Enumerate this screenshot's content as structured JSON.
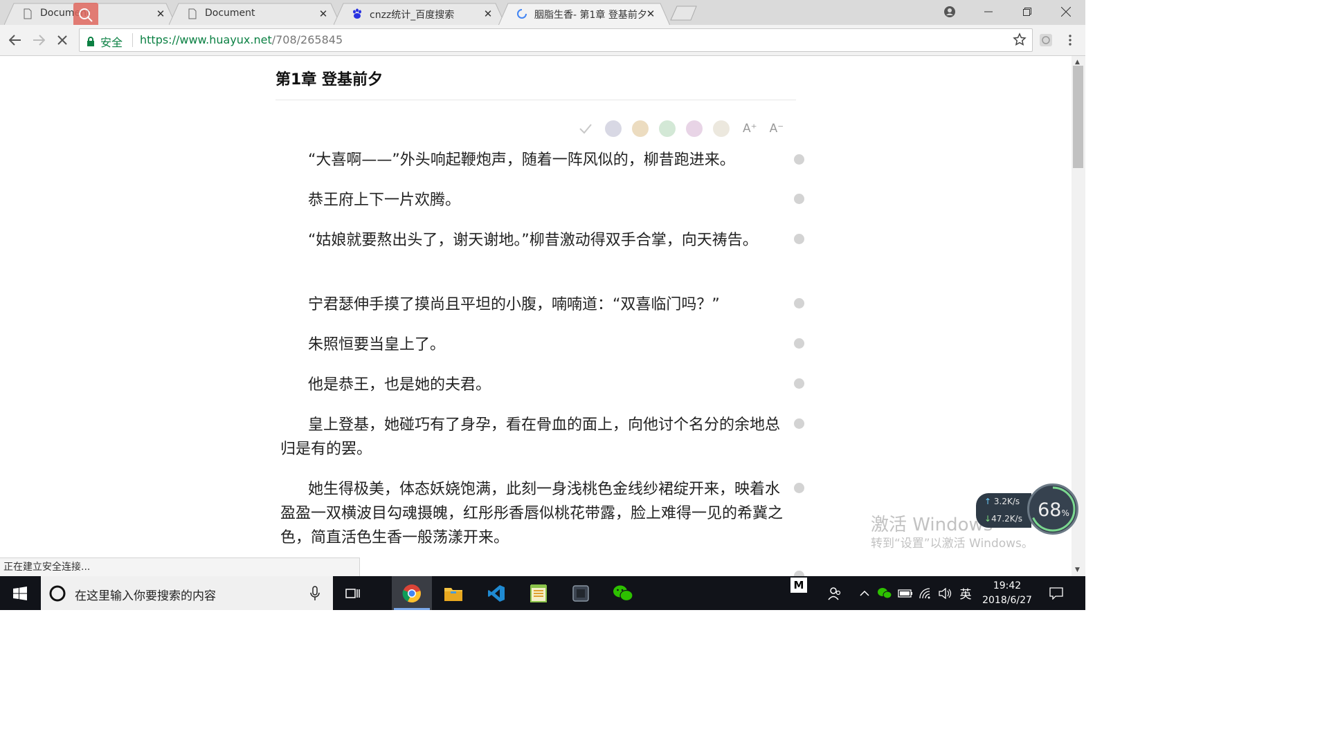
{
  "tabs": [
    {
      "label": "Document",
      "icon": "page-icon",
      "active": false
    },
    {
      "label": "Document",
      "icon": "page-icon",
      "active": false
    },
    {
      "label": "cnzz统计_百度搜索",
      "icon": "baidu-icon",
      "active": false
    },
    {
      "label": "胭脂生香- 第1章 登基前夕",
      "icon": "loading-spinner-icon",
      "active": true
    }
  ],
  "toolbar": {
    "secure_label": "安全",
    "url_host": "https://www.huayux.net",
    "url_path": "/708/265845"
  },
  "chapter": {
    "title": "第1章 登基前夕",
    "paragraphs": [
      "“大喜啊——”外头响起鞭炮声，随着一阵风似的，柳昔跑进来。",
      "恭王府上下一片欢腾。",
      "“姑娘就要熬出头了，谢天谢地。”柳昔激动得双手合掌，向天祷告。",
      "宁君瑟伸手摸了摸尚且平坦的小腹，喃喃道：“双喜临门吗？”",
      "朱照恒要当皇上了。",
      "他是恭王，也是她的夫君。",
      "皇上登基，她碰巧有了身孕，看在骨血的面上，向他讨个名分的余地总归是有的罢。",
      "她生得极美，体态妖娆饱满，此刻一身浅桃色金线纱裙绽开来，映着水盈盈一双横波目勾魂摄魄，红彤彤香唇似桃花带露，脸上难得一见的希冀之色，简直活色生香一般荡漾开来。"
    ]
  },
  "reader_settings": {
    "themes": [
      "#d8d8e4",
      "#ecdcc0",
      "#d3e8d6",
      "#e8d4e6",
      "#ece8de"
    ],
    "font_up": "A⁺",
    "font_down": "A⁻"
  },
  "status_text": "正在建立安全连接...",
  "watermark": {
    "line1": "激活 Windows",
    "line2": "转到“设置”以激活 Windows。"
  },
  "net_monitor": {
    "up": "3.2K/s",
    "down": "47.2K/s",
    "percent": "68",
    "percent_unit": "%"
  },
  "taskbar": {
    "search_placeholder": "在这里输入你要搜索的内容",
    "ime": "英",
    "time": "19:42",
    "date": "2018/6/27",
    "tray_letter": "M"
  }
}
